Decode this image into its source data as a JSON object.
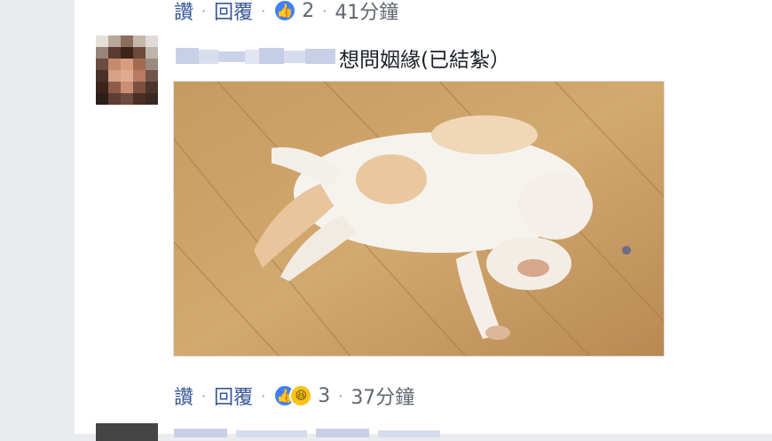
{
  "comments": [
    {
      "actions": {
        "like_label": "讚",
        "reply_label": "回覆",
        "reaction_count": "2",
        "time": "41分鐘"
      },
      "reactions": [
        "like-icon"
      ]
    },
    {
      "text": "想問姻緣(已結紮）",
      "author_blurred": true,
      "photo": {
        "subject": "cat-lying-on-back"
      },
      "actions": {
        "like_label": "讚",
        "reply_label": "回覆",
        "reaction_count": "3",
        "time": "37分鐘"
      },
      "reactions": [
        "like-icon",
        "haha-icon"
      ]
    }
  ],
  "colors": {
    "link": "#385898",
    "like": "#4080ff",
    "haha": "#f7c31b",
    "background": "#e9ebee"
  }
}
